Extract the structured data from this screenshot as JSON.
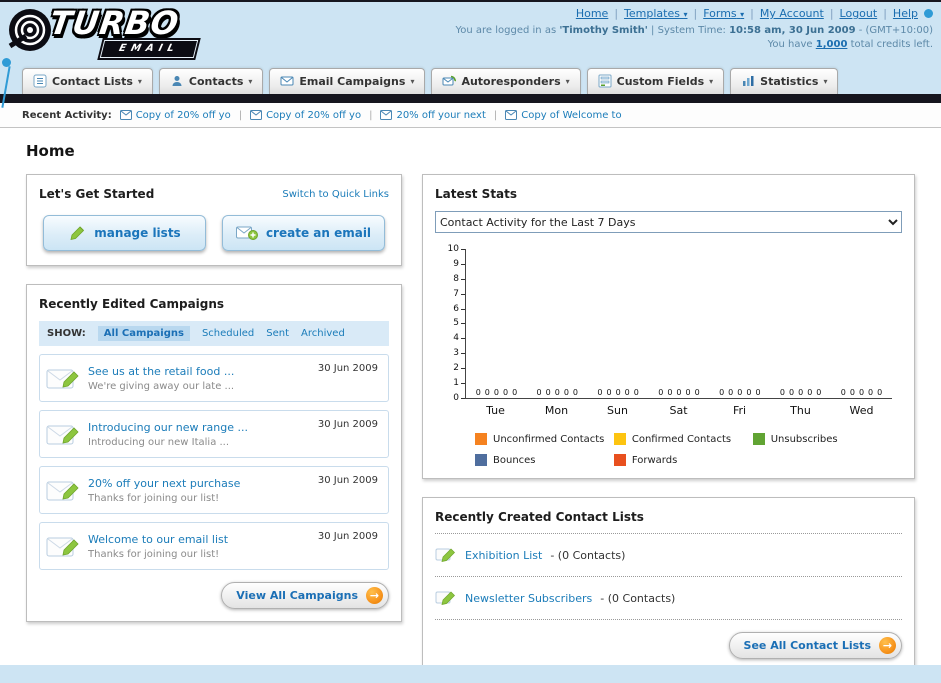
{
  "header": {
    "logo": {
      "line1": "TURBO",
      "line2": "EMAIL"
    },
    "separator": "|",
    "nav": {
      "home": "Home",
      "templates": "Templates",
      "forms": "Forms",
      "my_account": "My Account",
      "logout": "Logout",
      "help": "Help"
    },
    "session": {
      "prefix": "You are logged in as",
      "user": "'Timothy Smith'",
      "sep": "| System Time:",
      "time": "10:58 am, 30 Jun 2009",
      "gmt": "- (GMT+10:00)"
    },
    "credits": {
      "prefix": "You have",
      "value": "1,000",
      "suffix": "total credits left."
    }
  },
  "nav_tabs": [
    {
      "label": "Contact Lists"
    },
    {
      "label": "Contacts"
    },
    {
      "label": "Email Campaigns"
    },
    {
      "label": "Autoresponders"
    },
    {
      "label": "Custom Fields"
    },
    {
      "label": "Statistics"
    }
  ],
  "recent_activity": {
    "label": "Recent Activity:",
    "separator": "|",
    "items": [
      "Copy of 20% off yo",
      "Copy of 20% off yo",
      "20% off your next",
      "Copy of Welcome to"
    ]
  },
  "page_title": "Home",
  "get_started": {
    "title": "Let's Get Started",
    "switch_link": "Switch to Quick Links",
    "manage_lists_label": "manage lists",
    "create_email_label": "create an email"
  },
  "campaigns": {
    "title": "Recently Edited Campaigns",
    "show_label": "SHOW:",
    "tabs": [
      "All Campaigns",
      "Scheduled",
      "Sent",
      "Archived"
    ],
    "items": [
      {
        "title": "See us at the retail food ...",
        "subtitle": "We're giving away our late ...",
        "date": "30 Jun 2009"
      },
      {
        "title": "Introducing our new range ...",
        "subtitle": "Introducing our new Italia ...",
        "date": "30 Jun 2009"
      },
      {
        "title": "20% off your next purchase",
        "subtitle": "Thanks for joining our list!",
        "date": "30 Jun 2009"
      },
      {
        "title": "Welcome to our email list",
        "subtitle": "Thanks for joining our list!",
        "date": "30 Jun 2009"
      }
    ],
    "view_all_label": "View All Campaigns",
    "arrow_glyph": "→"
  },
  "latest_stats": {
    "title": "Latest Stats",
    "selected_option": "Contact Activity for the Last 7 Days",
    "chart_data": {
      "type": "bar",
      "title": "Contact Activity for the Last 7 Days",
      "categories": [
        "Tue",
        "Mon",
        "Sun",
        "Sat",
        "Fri",
        "Thu",
        "Wed"
      ],
      "series": [
        {
          "name": "Unconfirmed Contacts",
          "color": "#f58220",
          "values": [
            0,
            0,
            0,
            0,
            0,
            0,
            0
          ]
        },
        {
          "name": "Confirmed Contacts",
          "color": "#fdc410",
          "values": [
            0,
            0,
            0,
            0,
            0,
            0,
            0
          ]
        },
        {
          "name": "Unsubscribes",
          "color": "#61a433",
          "values": [
            0,
            0,
            0,
            0,
            0,
            0,
            0
          ]
        },
        {
          "name": "Bounces",
          "color": "#4f6e9e",
          "values": [
            0,
            0,
            0,
            0,
            0,
            0,
            0
          ]
        },
        {
          "name": "Forwards",
          "color": "#e8501e",
          "values": [
            0,
            0,
            0,
            0,
            0,
            0,
            0
          ]
        }
      ],
      "ylim": [
        0,
        10
      ],
      "ytick_step": 1,
      "grid": false,
      "legend_position": "bottom"
    }
  },
  "contact_lists": {
    "title": "Recently Created Contact Lists",
    "items": [
      {
        "name": "Exhibition List",
        "details": "- (0 Contacts)"
      },
      {
        "name": "Newsletter Subscribers",
        "details": "- (0 Contacts)"
      }
    ],
    "see_all_label": "See All Contact Lists",
    "arrow_glyph": "→"
  }
}
